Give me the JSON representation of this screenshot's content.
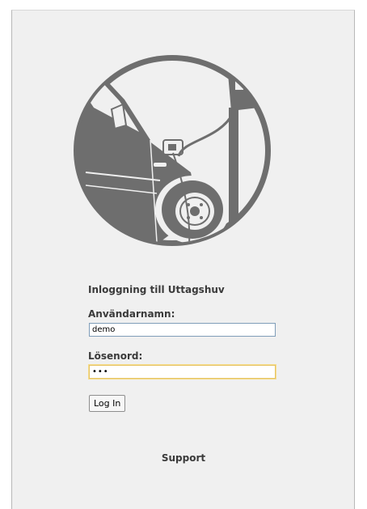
{
  "login": {
    "heading": "Inloggning till Uttagshuv",
    "username_label": "Användarnamn:",
    "username_value": "demo",
    "password_label": "Lösenord:",
    "password_value": "•••",
    "login_button": "Log In"
  },
  "footer": {
    "support_link": "Support"
  },
  "colors": {
    "logo_gray": "#6e6e6e",
    "panel_bg": "#f0f0f0",
    "input_border": "#7f9db9",
    "focus_border": "#e5c365"
  },
  "icons": {
    "logo": "electric-car-charging-logo-icon"
  }
}
